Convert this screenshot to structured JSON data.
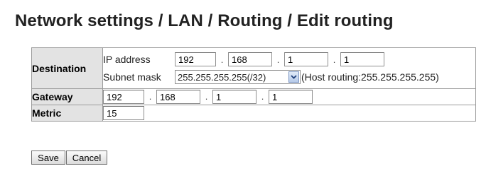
{
  "page": {
    "title": "Network settings / LAN / Routing / Edit routing"
  },
  "destination": {
    "label": "Destination",
    "ip_label": "IP address",
    "ip_octets": [
      "192",
      "168",
      "1",
      "1"
    ],
    "mask_label": "Subnet mask",
    "mask_selected": "255.255.255.255(/32)",
    "mask_note": "(Host routing:255.255.255.255)"
  },
  "gateway": {
    "label": "Gateway",
    "octets": [
      "192",
      "168",
      "1",
      "1"
    ]
  },
  "metric": {
    "label": "Metric",
    "value": "15"
  },
  "separator": ".",
  "buttons": {
    "save": "Save",
    "cancel": "Cancel"
  },
  "icons": {
    "select_arrow": "chevron-down-icon"
  }
}
